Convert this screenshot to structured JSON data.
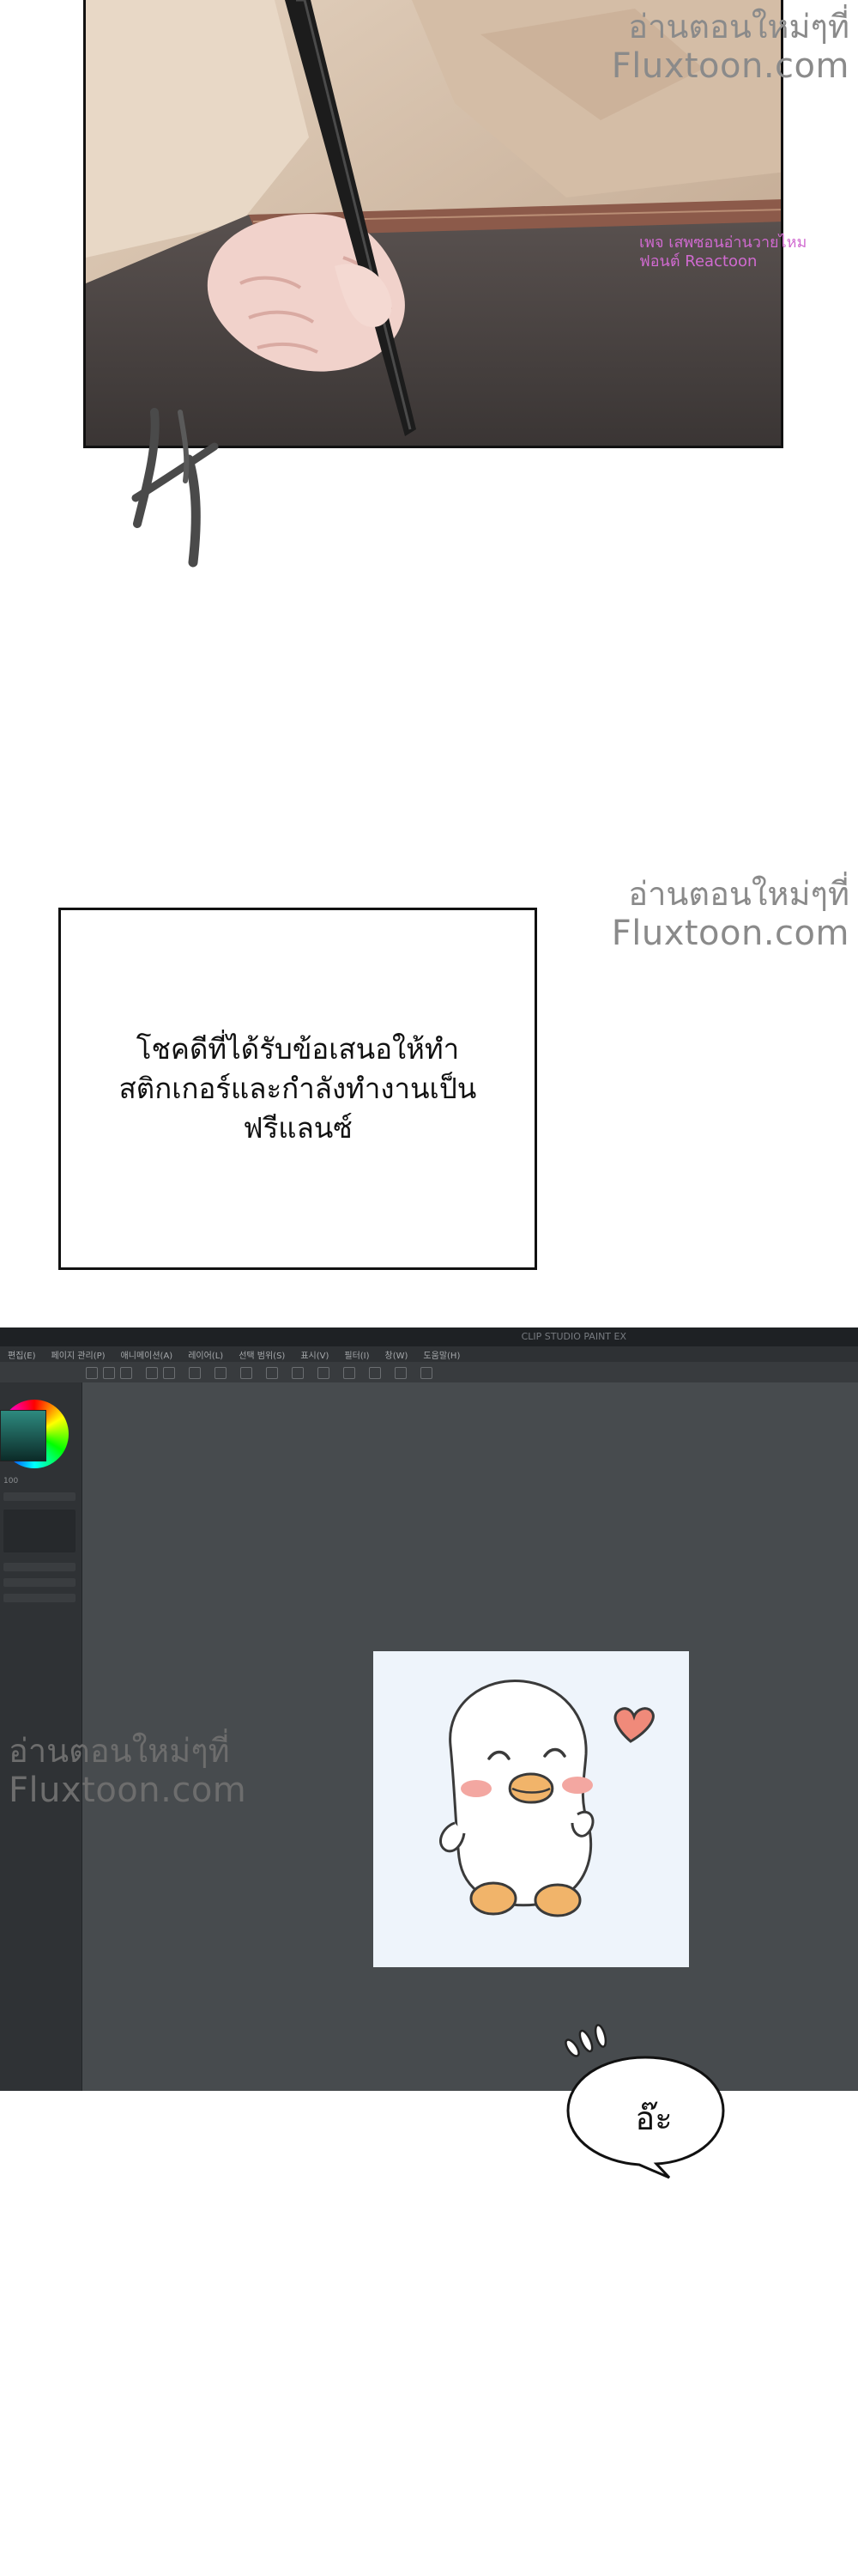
{
  "watermarks": {
    "top": {
      "line1": "อ่านตอนใหม่ๆที่",
      "line2": "Fluxtoon.com"
    },
    "small": {
      "line1": "เพจ เสพซอนอ่านวายไหม",
      "line2": "ฟอนต์ Reactoon"
    },
    "middle": {
      "line1": "อ่านตอนใหม่ๆที่",
      "line2": "Fluxtoon.com"
    },
    "screen": {
      "line1": "อ่านตอนใหม่ๆที่",
      "line2": "Fluxtoon.com"
    }
  },
  "caption": {
    "text": "โชคดีที่ได้รับข้อเสนอให้ทำ\nสติกเกอร์และกำลังทำงานเป็น\nฟรีแลนซ์"
  },
  "software": {
    "title": "CLIP STUDIO PAINT EX",
    "menu": [
      "편집(E)",
      "페이지 관리(P)",
      "애니메이션(A)",
      "레이어(L)",
      "선택 범위(S)",
      "표시(V)",
      "필터(I)",
      "창(W)",
      "도움말(H)"
    ],
    "zoom_readout": "100",
    "canvas_bg": "#eef4fb"
  },
  "speech_bubble": {
    "text": "อ๊ะ"
  },
  "colors": {
    "panel_border": "#111111",
    "screen_bg": "#474b4e",
    "watermark": "#8a8a8a",
    "duck_cheek": "#f3a7a1",
    "duck_beak": "#f1b46a",
    "heart": "#f08a7a"
  }
}
